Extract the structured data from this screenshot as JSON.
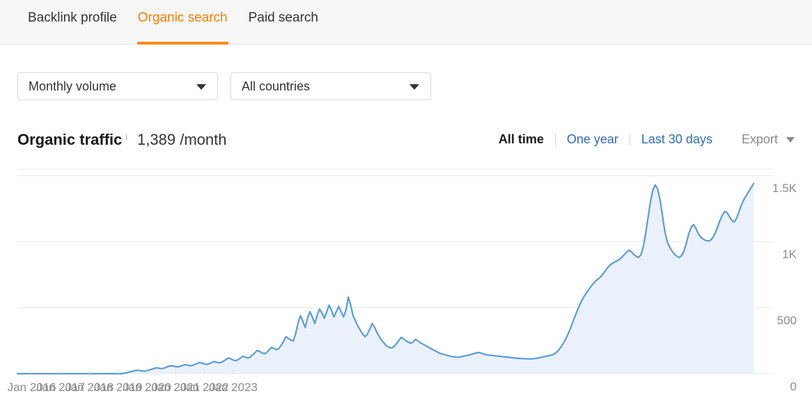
{
  "tabs": [
    {
      "label": "Backlink profile",
      "active": false
    },
    {
      "label": "Organic search",
      "active": true
    },
    {
      "label": "Paid search",
      "active": false
    }
  ],
  "filters": [
    {
      "name": "metric-select",
      "value": "Monthly volume"
    },
    {
      "name": "country-select",
      "value": "All countries"
    }
  ],
  "metric": {
    "title": "Organic traffic",
    "info_icon": "i",
    "value": "1,389 /month"
  },
  "ranges": [
    {
      "label": "All time",
      "active": true
    },
    {
      "label": "One year",
      "active": false
    },
    {
      "label": "Last 30 days",
      "active": false
    }
  ],
  "export": {
    "label": "Export",
    "icon": "chevron-down-icon"
  },
  "colors": {
    "accent_orange": "#f98a0b",
    "tab_active_text": "#ff7a00",
    "link_blue": "#2b6cb8",
    "line_blue": "#5b9bd5",
    "area_fill": "#eaf1fb",
    "grid": "#e8e8e8",
    "axis_text": "#8c8c8c"
  },
  "chart_data": {
    "type": "area",
    "title": "Organic traffic",
    "xlabel": "",
    "ylabel": "",
    "ylim": [
      0,
      1550
    ],
    "yticks": [
      0,
      500,
      1000,
      1500
    ],
    "ytick_labels": [
      "0",
      "500",
      "1K",
      "1.5K"
    ],
    "grid": true,
    "legend": false,
    "xtick_labels": [
      "Jan 2016",
      "Jan 2017",
      "Jan 2018",
      "Jan 2019",
      "Jan 2020",
      "Jan 2021",
      "Jan 2022",
      "Jan 2023"
    ],
    "x_start": "2015-07",
    "x_end": "2023-06",
    "series": [
      {
        "name": "Organic traffic",
        "unit": "visits/month",
        "values": [
          0,
          0,
          0,
          0,
          0,
          0,
          0,
          0,
          0,
          0,
          0,
          0,
          0,
          0,
          0,
          0,
          0,
          0,
          0,
          0,
          0,
          0,
          0,
          0,
          0,
          0,
          0,
          0,
          0,
          0,
          0,
          0,
          0,
          0,
          0,
          0,
          0,
          0,
          0,
          0,
          0,
          0,
          0,
          0,
          2,
          5,
          9,
          14,
          18,
          22,
          26,
          24,
          21,
          19,
          22,
          28,
          34,
          40,
          45,
          42,
          38,
          41,
          48,
          55,
          60,
          58,
          54,
          52,
          57,
          63,
          68,
          64,
          60,
          63,
          70,
          78,
          84,
          80,
          74,
          70,
          76,
          84,
          92,
          88,
          82,
          86,
          96,
          108,
          120,
          112,
          104,
          98,
          106,
          118,
          132,
          126,
          118,
          124,
          140,
          158,
          176,
          168,
          158,
          150,
          162,
          180,
          200,
          192,
          182,
          190,
          215,
          245,
          280,
          268,
          255,
          248,
          300,
          380,
          440,
          400,
          350,
          420,
          470,
          430,
          380,
          440,
          490,
          460,
          420,
          470,
          520,
          480,
          430,
          470,
          510,
          470,
          430,
          480,
          580,
          520,
          440,
          400,
          360,
          330,
          300,
          280,
          300,
          340,
          380,
          350,
          310,
          280,
          250,
          230,
          210,
          200,
          195,
          205,
          225,
          250,
          275,
          265,
          250,
          240,
          230,
          240,
          260,
          250,
          235,
          225,
          215,
          205,
          195,
          185,
          175,
          165,
          155,
          150,
          145,
          140,
          135,
          130,
          128,
          126,
          125,
          128,
          132,
          136,
          140,
          145,
          150,
          155,
          160,
          158,
          152,
          146,
          142,
          140,
          138,
          136,
          134,
          132,
          130,
          128,
          126,
          124,
          122,
          120,
          118,
          116,
          115,
          114,
          113,
          112,
          112,
          113,
          115,
          118,
          122,
          126,
          130,
          134,
          138,
          142,
          150,
          165,
          185,
          210,
          240,
          275,
          315,
          360,
          410,
          455,
          500,
          540,
          575,
          605,
          630,
          655,
          680,
          700,
          715,
          730,
          750,
          775,
          800,
          820,
          835,
          845,
          855,
          865,
          880,
          900,
          920,
          935,
          925,
          905,
          890,
          880,
          900,
          960,
          1060,
          1180,
          1300,
          1390,
          1430,
          1400,
          1320,
          1200,
          1080,
          1000,
          960,
          930,
          905,
          890,
          880,
          895,
          930,
          990,
          1060,
          1110,
          1130,
          1100,
          1060,
          1035,
          1020,
          1010,
          1005,
          1010,
          1030,
          1065,
          1110,
          1160,
          1200,
          1230,
          1220,
          1190,
          1160,
          1150,
          1180,
          1230,
          1280,
          1320,
          1350,
          1380,
          1410,
          1440
        ]
      }
    ]
  }
}
